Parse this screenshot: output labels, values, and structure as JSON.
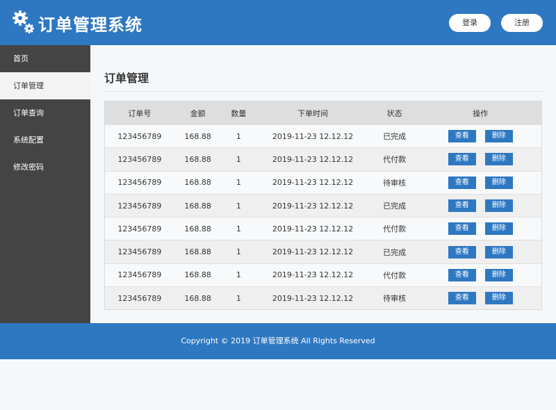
{
  "header": {
    "title": "订单管理系统",
    "logo_icon": "gears-icon",
    "login_label": "登录",
    "register_label": "注册"
  },
  "sidebar": {
    "items": [
      {
        "label": "首页",
        "active": false
      },
      {
        "label": "订单管理",
        "active": true
      },
      {
        "label": "订单查询",
        "active": false
      },
      {
        "label": "系统配置",
        "active": false
      },
      {
        "label": "修改密码",
        "active": false
      }
    ]
  },
  "main": {
    "title": "订单管理",
    "table": {
      "columns": [
        "订单号",
        "金额",
        "数量",
        "下单时间",
        "状态",
        "操作"
      ],
      "view_label": "查看",
      "delete_label": "删除",
      "rows": [
        {
          "order_id": "123456789",
          "amount": "168.88",
          "qty": "1",
          "time": "2019-11-23 12.12.12",
          "status": "已完成"
        },
        {
          "order_id": "123456789",
          "amount": "168.88",
          "qty": "1",
          "time": "2019-11-23 12.12.12",
          "status": "代付款"
        },
        {
          "order_id": "123456789",
          "amount": "168.88",
          "qty": "1",
          "time": "2019-11-23 12.12.12",
          "status": "待审核"
        },
        {
          "order_id": "123456789",
          "amount": "168.88",
          "qty": "1",
          "time": "2019-11-23 12.12.12",
          "status": "已完成"
        },
        {
          "order_id": "123456789",
          "amount": "168.88",
          "qty": "1",
          "time": "2019-11-23 12.12.12",
          "status": "代付款"
        },
        {
          "order_id": "123456789",
          "amount": "168.88",
          "qty": "1",
          "time": "2019-11-23 12.12.12",
          "status": "已完成"
        },
        {
          "order_id": "123456789",
          "amount": "168.88",
          "qty": "1",
          "time": "2019-11-23 12.12.12",
          "status": "代付款"
        },
        {
          "order_id": "123456789",
          "amount": "168.88",
          "qty": "1",
          "time": "2019-11-23 12.12.12",
          "status": "待审核"
        }
      ]
    }
  },
  "footer": {
    "copyright": "Copyright © 2019 订单管理系统 All Rights Reserved"
  },
  "colors": {
    "brand": "#2e78c2",
    "sidebar": "#444444",
    "sidebar_active": "#f3f3f3"
  }
}
